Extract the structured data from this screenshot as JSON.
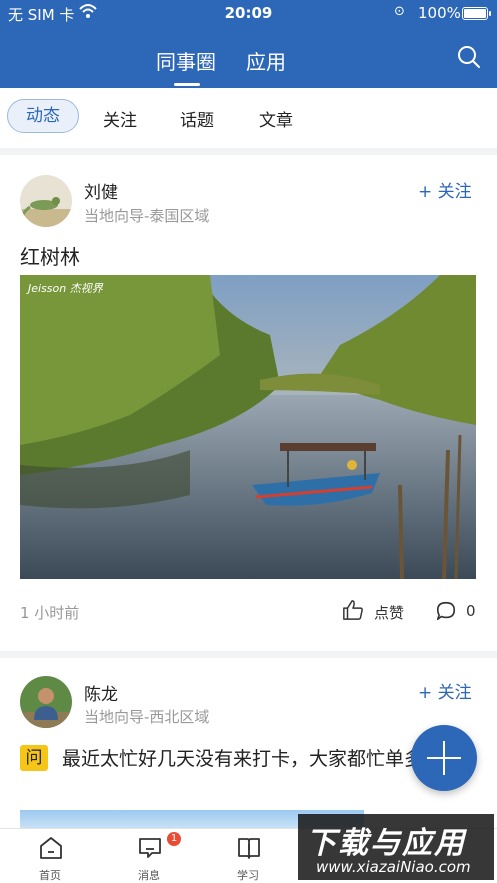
{
  "status_bar": {
    "carrier": "无 SIM 卡",
    "time": "20:09",
    "battery": "100%"
  },
  "header": {
    "tabs": [
      {
        "label": "同事圈",
        "active": true
      },
      {
        "label": "应用",
        "active": false
      }
    ],
    "search_icon": "search-icon"
  },
  "sub_tabs": [
    {
      "label": "动态",
      "active": true
    },
    {
      "label": "关注"
    },
    {
      "label": "话题"
    },
    {
      "label": "文章"
    }
  ],
  "posts": [
    {
      "author": "刘健",
      "subtitle": "当地向导-泰国区域",
      "follow_label": "+ 关注",
      "title": "红树林",
      "image_mark": "Jeisson 杰视界",
      "time_ago": "1 小时前",
      "like_label": "点赞",
      "comment_count": "0"
    },
    {
      "author": "陈龙",
      "subtitle": "当地向导-西北区域",
      "follow_label": "+ 关注",
      "question_badge": "问",
      "text": "最近太忙好几天没有来打卡，大家都忙单多吗?"
    }
  ],
  "bottom_nav": [
    {
      "label": "首页",
      "icon": "home-icon"
    },
    {
      "label": "消息",
      "icon": "message-icon",
      "badge": "1"
    },
    {
      "label": "学习",
      "icon": "book-icon"
    }
  ],
  "watermark": {
    "title": "下载与应用",
    "url": "www.xiazaiNiao.com"
  },
  "colors": {
    "brand": "#2d67b8",
    "badge": "#e94b35",
    "question_badge": "#f5c518"
  }
}
